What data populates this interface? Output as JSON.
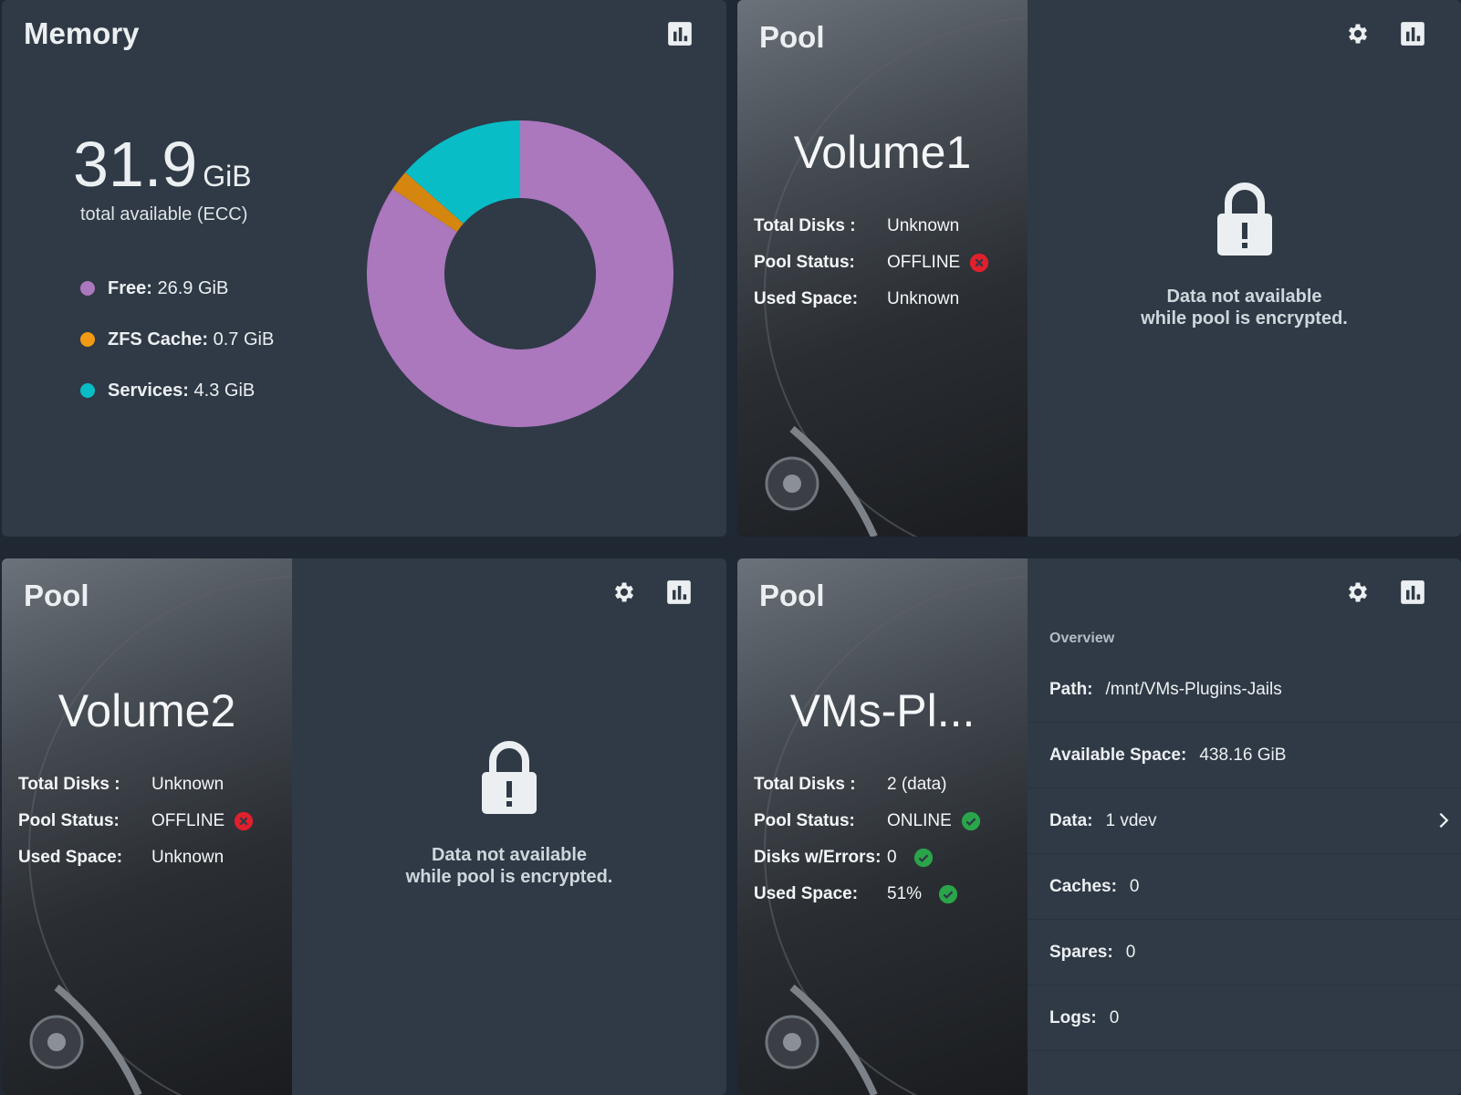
{
  "memory": {
    "title": "Memory",
    "total_value": "31.9",
    "total_unit": "GiB",
    "subtitle": "total available (ECC)",
    "legend": [
      {
        "label": "Free:",
        "value": "26.9 GiB",
        "color": "#ab77bd"
      },
      {
        "label": "ZFS Cache:",
        "value": "0.7 GiB",
        "color": "#f29a13"
      },
      {
        "label": "Services:",
        "value": "4.3 GiB",
        "color": "#08bdc6"
      }
    ],
    "icons": [
      "bar-chart-icon"
    ]
  },
  "chart_data": {
    "type": "pie",
    "donut": true,
    "categories": [
      "Free",
      "ZFS Cache",
      "Services"
    ],
    "values": [
      26.9,
      0.7,
      4.3
    ],
    "colors": [
      "#ab77bd",
      "#d4860f",
      "#08bdc6"
    ]
  },
  "pools": [
    {
      "title": "Pool",
      "name": "Volume1",
      "stats": [
        {
          "label": "Total Disks :",
          "value": "Unknown",
          "status": ""
        },
        {
          "label": "Pool Status:",
          "value": "OFFLINE",
          "status": "error"
        },
        {
          "label": "Used Space:",
          "value": "Unknown",
          "status": ""
        }
      ],
      "locked_line1": "Data not available",
      "locked_line2": "while pool is encrypted."
    },
    {
      "title": "Pool",
      "name": "Volume2",
      "stats": [
        {
          "label": "Total Disks :",
          "value": "Unknown",
          "status": ""
        },
        {
          "label": "Pool Status:",
          "value": "OFFLINE",
          "status": "error"
        },
        {
          "label": "Used Space:",
          "value": "Unknown",
          "status": ""
        }
      ],
      "locked_line1": "Data not available",
      "locked_line2": "while pool is encrypted."
    },
    {
      "title": "Pool",
      "name": "VMs-Pl...",
      "stats": [
        {
          "label": "Total Disks :",
          "value": "2 (data)",
          "status": ""
        },
        {
          "label": "Pool Status:",
          "value": "ONLINE",
          "status": "ok"
        },
        {
          "label": "Disks w/Errors:",
          "value": "0",
          "status": "ok"
        },
        {
          "label": "Used Space:",
          "value": "51%",
          "status": "ok"
        }
      ],
      "overview": {
        "title": "Overview",
        "rows": [
          {
            "label": "Path:",
            "value": "/mnt/VMs-Plugins-Jails"
          },
          {
            "label": "Available Space:",
            "value": "438.16 GiB"
          },
          {
            "label": "Data:",
            "value": "1 vdev"
          },
          {
            "label": "Caches:",
            "value": "0"
          },
          {
            "label": "Spares:",
            "value": "0"
          },
          {
            "label": "Logs:",
            "value": "0"
          }
        ]
      }
    }
  ],
  "colors": {
    "card_bg": "#2f3a46",
    "page_bg": "#1f2833",
    "error": "#e0202c",
    "ok": "#2aa54a"
  }
}
